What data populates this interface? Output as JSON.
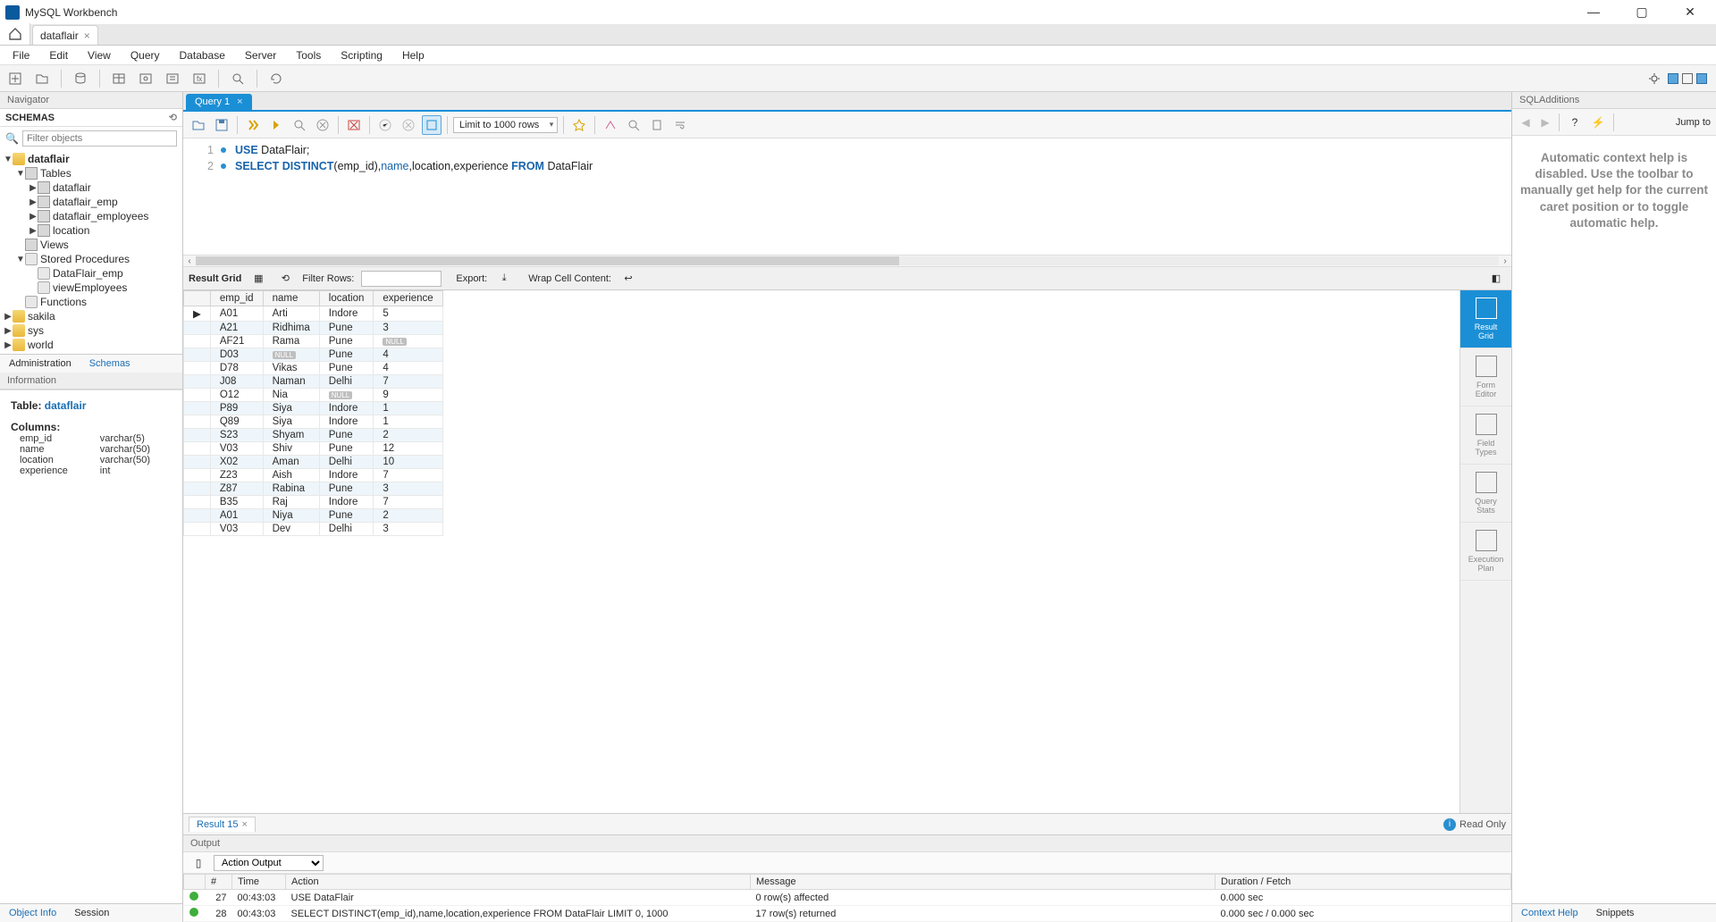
{
  "window": {
    "title": "MySQL Workbench"
  },
  "connection_tab": {
    "label": "dataflair"
  },
  "menu": [
    "File",
    "Edit",
    "View",
    "Query",
    "Database",
    "Server",
    "Tools",
    "Scripting",
    "Help"
  ],
  "navigator": {
    "header": "Navigator",
    "schemas_label": "SCHEMAS",
    "filter_placeholder": "Filter objects",
    "tree": {
      "db": "dataflair",
      "tables_label": "Tables",
      "tables": [
        "dataflair",
        "dataflair_emp",
        "dataflair_employees",
        "location"
      ],
      "views_label": "Views",
      "procs_label": "Stored Procedures",
      "procs": [
        "DataFlair_emp",
        "viewEmployees"
      ],
      "funcs_label": "Functions",
      "other_dbs": [
        "sakila",
        "sys",
        "world"
      ]
    },
    "bottom_tabs": {
      "admin": "Administration",
      "schemas": "Schemas"
    },
    "info_header": "Information",
    "info": {
      "table_label": "Table: ",
      "table_name": "dataflair",
      "columns_label": "Columns:",
      "columns": [
        {
          "name": "emp_id",
          "type": "varchar(5)"
        },
        {
          "name": "name",
          "type": "varchar(50)"
        },
        {
          "name": "location",
          "type": "varchar(50)"
        },
        {
          "name": "experience",
          "type": "int"
        }
      ]
    },
    "bottom_tabs2": {
      "obj": "Object Info",
      "session": "Session"
    }
  },
  "query_tab": {
    "label": "Query 1"
  },
  "limit": "Limit to 1000 rows",
  "code": {
    "l1": {
      "n": "1",
      "seg": [
        [
          "kw",
          "USE"
        ],
        [
          "plain",
          " DataFlair;"
        ]
      ]
    },
    "l2": {
      "n": "2",
      "seg": [
        [
          "kw",
          "SELECT DISTINCT"
        ],
        [
          "plain",
          "(emp_id),"
        ],
        [
          "ident",
          "name"
        ],
        [
          "plain",
          ",location,experience "
        ],
        [
          "kw",
          "FROM"
        ],
        [
          "plain",
          " DataFlair"
        ]
      ]
    }
  },
  "resultbar": {
    "grid_label": "Result Grid",
    "filter_label": "Filter Rows:",
    "export_label": "Export:",
    "wrap_label": "Wrap Cell Content:"
  },
  "grid": {
    "cols": [
      "emp_id",
      "name",
      "location",
      "experience"
    ],
    "rows": [
      [
        "A01",
        "Arti",
        "Indore",
        "5"
      ],
      [
        "A21",
        "Ridhima",
        "Pune",
        "3"
      ],
      [
        "AF21",
        "Rama",
        "Pune",
        "NULL"
      ],
      [
        "D03",
        "NULL",
        "Pune",
        "4"
      ],
      [
        "D78",
        "Vikas",
        "Pune",
        "4"
      ],
      [
        "J08",
        "Naman",
        "Delhi",
        "7"
      ],
      [
        "O12",
        "Nia",
        "NULL",
        "9"
      ],
      [
        "P89",
        "Siya",
        "Indore",
        "1"
      ],
      [
        "Q89",
        "Siya",
        "Indore",
        "1"
      ],
      [
        "S23",
        "Shyam",
        "Pune",
        "2"
      ],
      [
        "V03",
        "Shiv",
        "Pune",
        "12"
      ],
      [
        "X02",
        "Aman",
        "Delhi",
        "10"
      ],
      [
        "Z23",
        "Aish",
        "Indore",
        "7"
      ],
      [
        "Z87",
        "Rabina",
        "Pune",
        "3"
      ],
      [
        "B35",
        "Raj",
        "Indore",
        "7"
      ],
      [
        "A01",
        "Niya",
        "Pune",
        "2"
      ],
      [
        "V03",
        "Dev",
        "Delhi",
        "3"
      ]
    ]
  },
  "side_tabs": [
    "Result Grid",
    "Form Editor",
    "Field Types",
    "Query Stats",
    "Execution Plan"
  ],
  "result_footer": {
    "tab": "Result 15",
    "readonly": "Read Only"
  },
  "output": {
    "header": "Output",
    "selector": "Action Output",
    "cols": [
      "",
      "#",
      "Time",
      "Action",
      "Message",
      "Duration / Fetch"
    ],
    "rows": [
      {
        "n": "27",
        "time": "00:43:03",
        "action": "USE DataFlair",
        "msg": "0 row(s) affected",
        "dur": "0.000 sec"
      },
      {
        "n": "28",
        "time": "00:43:03",
        "action": "SELECT DISTINCT(emp_id),name,location,experience FROM DataFlair LIMIT 0, 1000",
        "msg": "17 row(s) returned",
        "dur": "0.000 sec / 0.000 sec"
      }
    ]
  },
  "sql_additions": {
    "header": "SQLAdditions",
    "jump": "Jump to",
    "help": "Automatic context help is disabled. Use the toolbar to manually get help for the current caret position or to toggle automatic help.",
    "tabs": {
      "ctx": "Context Help",
      "snip": "Snippets"
    }
  }
}
